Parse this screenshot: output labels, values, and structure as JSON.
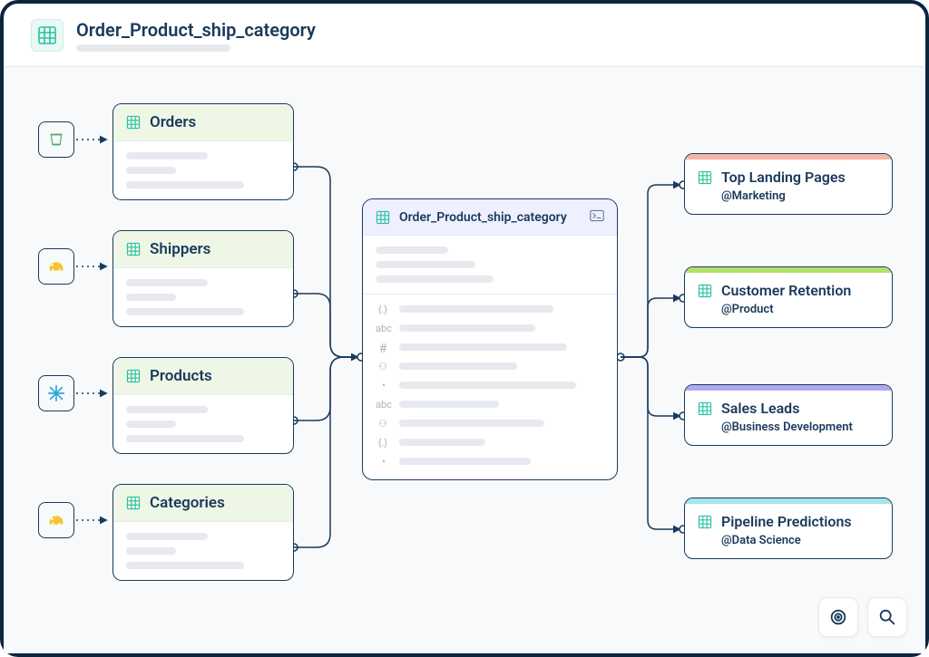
{
  "header": {
    "title": "Order_Product_ship_category"
  },
  "sources": [
    {
      "icon": "bucket",
      "iconColor": "#4aa96c",
      "label": "Orders"
    },
    {
      "icon": "elephant",
      "iconColor": "#f4c430",
      "label": "Shippers"
    },
    {
      "icon": "snowflake",
      "iconColor": "#29a5d6",
      "label": "Products"
    },
    {
      "icon": "elephant",
      "iconColor": "#f4c430",
      "label": "Categories"
    }
  ],
  "center": {
    "title": "Order_Product_ship_category"
  },
  "fieldTypes": [
    "json",
    "abc",
    "hash",
    "tree",
    "clock",
    "abc",
    "tree",
    "json",
    "clock"
  ],
  "outputs": [
    {
      "barColor": "#f6b6a4",
      "title": "Top Landing Pages",
      "owner": "@Marketing"
    },
    {
      "barColor": "#b4e06a",
      "title": "Customer Retention",
      "owner": "@Product"
    },
    {
      "barColor": "#b3a8ef",
      "title": "Sales Leads",
      "owner": "@Business Development"
    },
    {
      "barColor": "#a4e4eb",
      "title": "Pipeline Predictions",
      "owner": "@Data Science"
    }
  ]
}
